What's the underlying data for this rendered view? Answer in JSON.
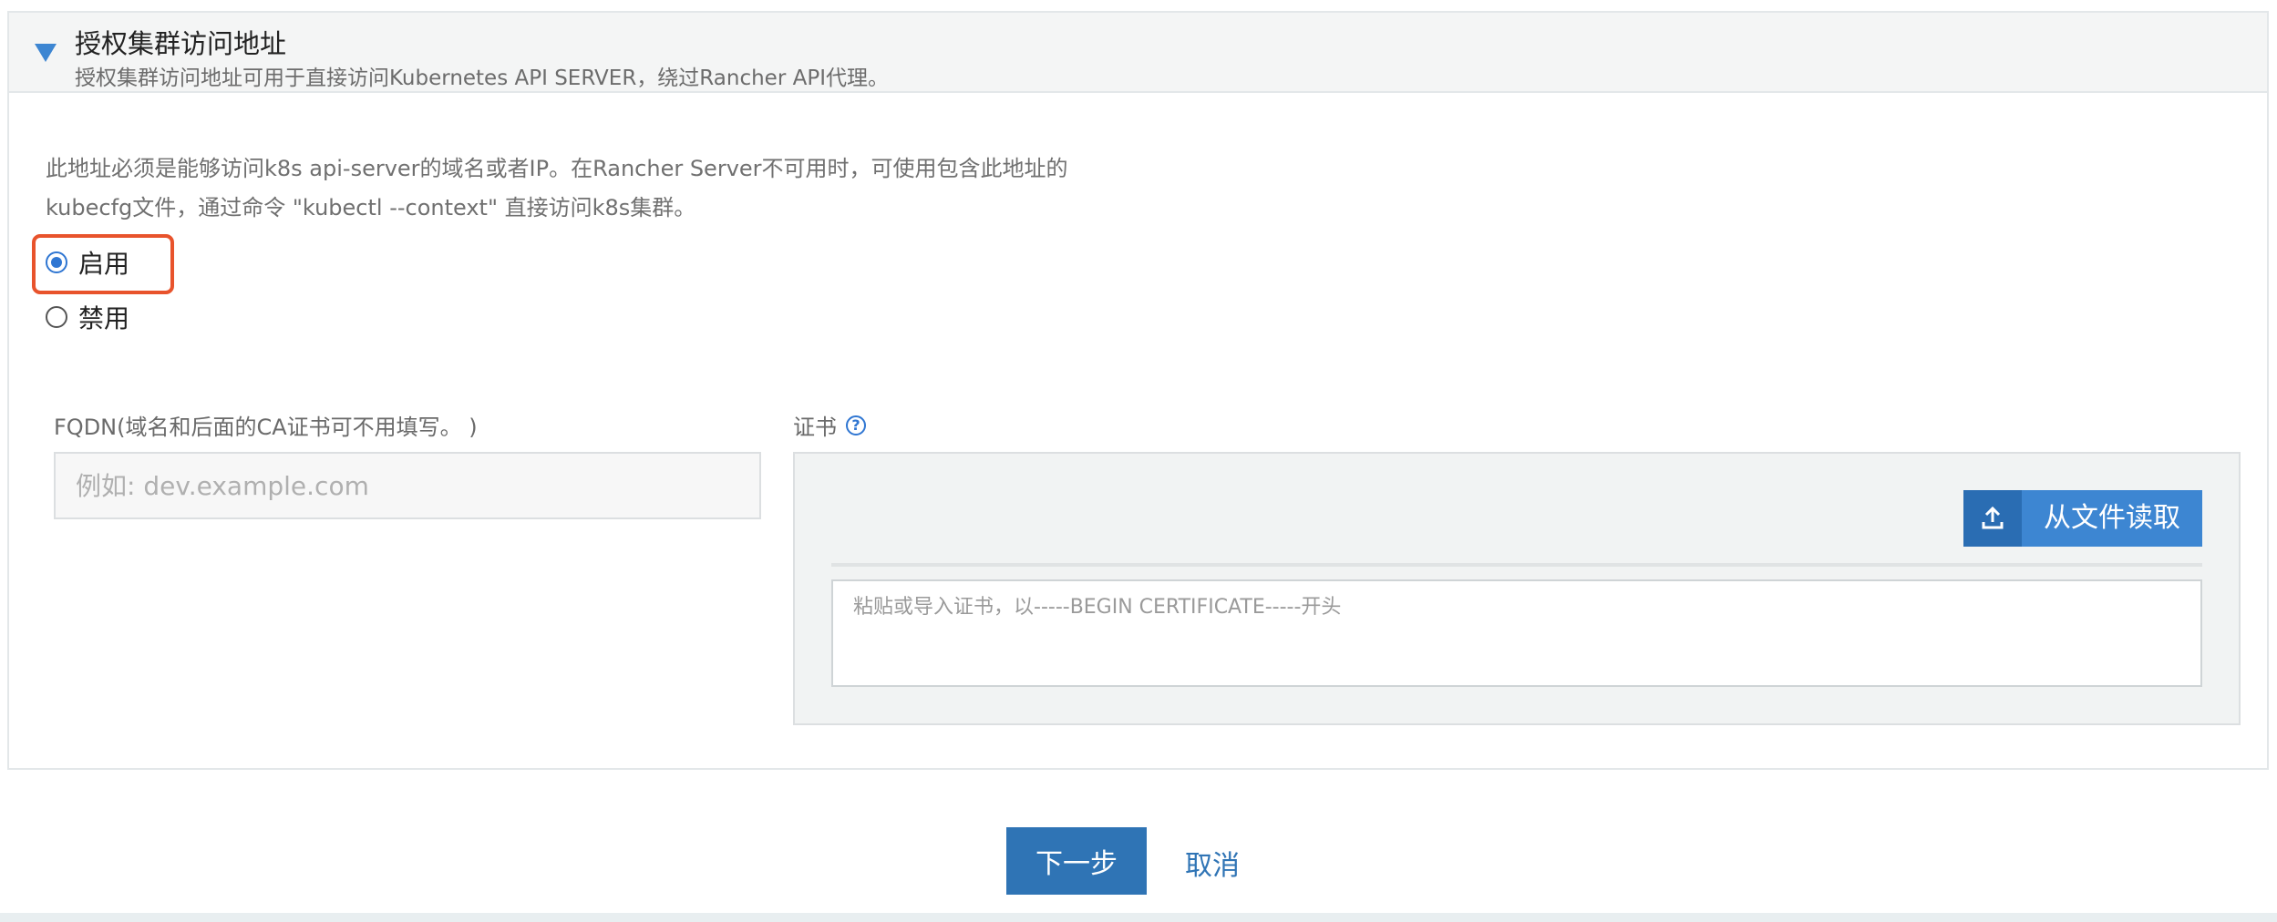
{
  "section": {
    "title": "授权集群访问地址",
    "subtitle": "授权集群访问地址可用于直接访问Kubernetes API SERVER，绕过Rancher API代理。"
  },
  "description": {
    "line1": "此地址必须是能够访问k8s api-server的域名或者IP。在Rancher Server不可用时，可使用包含此地址的",
    "line2": "kubecfg文件，通过命令 \"kubectl --context\" 直接访问k8s集群。"
  },
  "access_options": {
    "selected": "启用",
    "items": [
      {
        "label": "启用",
        "checked": true
      },
      {
        "label": "禁用",
        "checked": false
      }
    ]
  },
  "fqdn": {
    "label": "FQDN(域名和后面的CA证书可不用填写。 )",
    "placeholder": "例如: dev.example.com",
    "value": ""
  },
  "certificate": {
    "label": "证书",
    "read_file_button": "从文件读取",
    "placeholder": "粘贴或导入证书，以-----BEGIN CERTIFICATE-----开头",
    "value": ""
  },
  "actions": {
    "next": "下一步",
    "cancel": "取消"
  },
  "icons": {
    "collapse": "caret-down-icon",
    "help": "question-circle-icon",
    "upload": "upload-icon"
  },
  "colors": {
    "accent": "#3d86d2",
    "primary_button": "#2f74b5",
    "highlight_border": "#e8532c"
  }
}
